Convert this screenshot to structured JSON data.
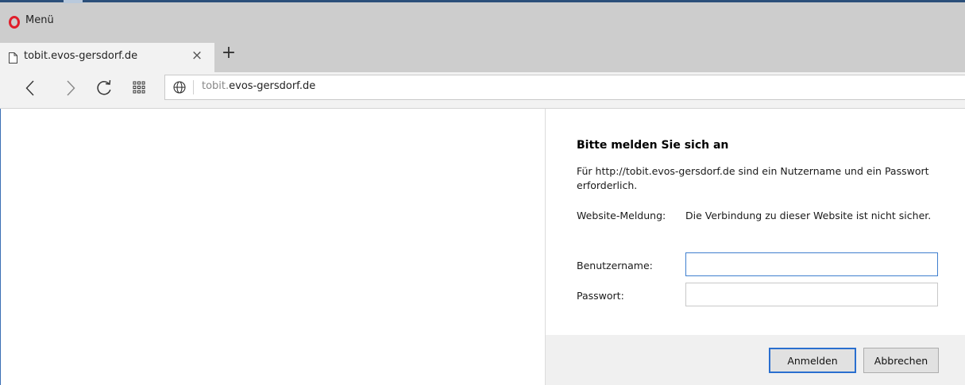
{
  "browser": {
    "menu_label": "Menü",
    "tab": {
      "title": "tobit.evos-gersdorf.de",
      "close_glyph": "×"
    },
    "new_tab_glyph": "+",
    "address": {
      "subdomain": "tobit.",
      "host": "evos-gersdorf.de"
    },
    "icons": [
      "opera-logo-icon",
      "page-icon",
      "close-icon",
      "plus-icon",
      "back-icon",
      "forward-icon",
      "reload-icon",
      "speed-dial-icon",
      "globe-icon"
    ],
    "accent_color": "#e01e2b"
  },
  "dialog": {
    "title": "Bitte melden Sie sich an",
    "description": "Für http://tobit.evos-gersdorf.de sind ein Nutzername und ein Passwort erforderlich.",
    "site_label": "Website-Meldung:",
    "site_message": "Die Verbindung zu dieser Website ist nicht sicher.",
    "username_label": "Benutzername:",
    "username_value": "",
    "password_label": "Passwort:",
    "password_value": "",
    "login_button": "Anmelden",
    "cancel_button": "Abbrechen",
    "focus_color": "#3f7fcf"
  }
}
